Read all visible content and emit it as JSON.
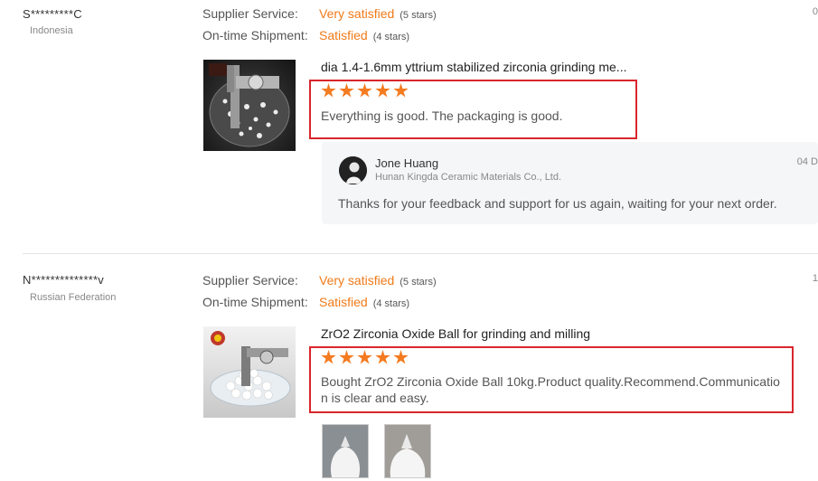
{
  "reviews": [
    {
      "buyer_name": "S*********C",
      "buyer_country": "Indonesia",
      "date_partial": "0",
      "supplier_service": {
        "label": "Supplier Service:",
        "value": "Very satisfied",
        "stars_text": "(5 stars)"
      },
      "ontime_shipment": {
        "label": "On-time Shipment:",
        "value": "Satisfied",
        "stars_text": "(4 stars)"
      },
      "product_title": "dia 1.4-1.6mm yttrium stabilized zirconia grinding me...",
      "rating": 5,
      "review_text": "Everything is good. The packaging is good.",
      "reply": {
        "name": "Jone Huang",
        "company": "Hunan Kingda Ceramic Materials Co., Ltd.",
        "date": "04 D",
        "text": "Thanks for your feedback and support for us again, waiting for your next order."
      }
    },
    {
      "buyer_name": "N**************v",
      "buyer_country": "Russian Federation",
      "date_partial": "1",
      "supplier_service": {
        "label": "Supplier Service:",
        "value": "Very satisfied",
        "stars_text": "(5 stars)"
      },
      "ontime_shipment": {
        "label": "On-time Shipment:",
        "value": "Satisfied",
        "stars_text": "(4 stars)"
      },
      "product_title": "ZrO2 Zirconia Oxide Ball for grinding and milling",
      "rating": 5,
      "review_text_line1": "Bought ZrO2 Zirconia Oxide Ball 10kg.Product quality.Recommend.Communicatio",
      "review_text_line2": "n is clear and easy."
    }
  ],
  "colors": {
    "accent": "#f07a18",
    "star": "#f47b20",
    "highlight_box": "#d9262c"
  }
}
